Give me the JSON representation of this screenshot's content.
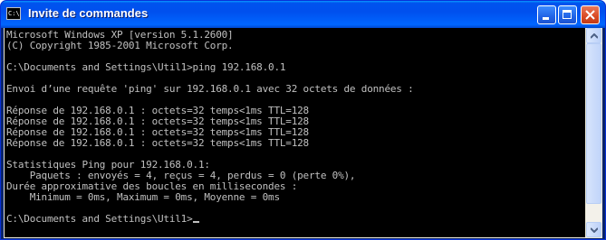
{
  "window": {
    "title": "Invite de commandes",
    "icon": "cmd-icon",
    "icon_text": "C:\\"
  },
  "console": {
    "lines": [
      "Microsoft Windows XP [version 5.1.2600]",
      "(C) Copyright 1985-2001 Microsoft Corp.",
      "",
      "C:\\Documents and Settings\\Util1>ping 192.168.0.1",
      "",
      "Envoi d’une requête 'ping' sur 192.168.0.1 avec 32 octets de données :",
      "",
      "Réponse de 192.168.0.1 : octets=32 temps<1ms TTL=128",
      "Réponse de 192.168.0.1 : octets=32 temps<1ms TTL=128",
      "Réponse de 192.168.0.1 : octets=32 temps<1ms TTL=128",
      "Réponse de 192.168.0.1 : octets=32 temps<1ms TTL=128",
      "",
      "Statistiques Ping pour 192.168.0.1:",
      "    Paquets : envoyés = 4, reçus = 4, perdus = 0 (perte 0%),",
      "Durée approximative des boucles en millisecondes :",
      "    Minimum = 0ms, Maximum = 0ms, Moyenne = 0ms",
      "",
      "C:\\Documents and Settings\\Util1>"
    ]
  },
  "colors": {
    "console_background": "#000000",
    "console_text": "#c0c0c0",
    "titlebar": "#0053ee",
    "close_button": "#d94a24"
  }
}
